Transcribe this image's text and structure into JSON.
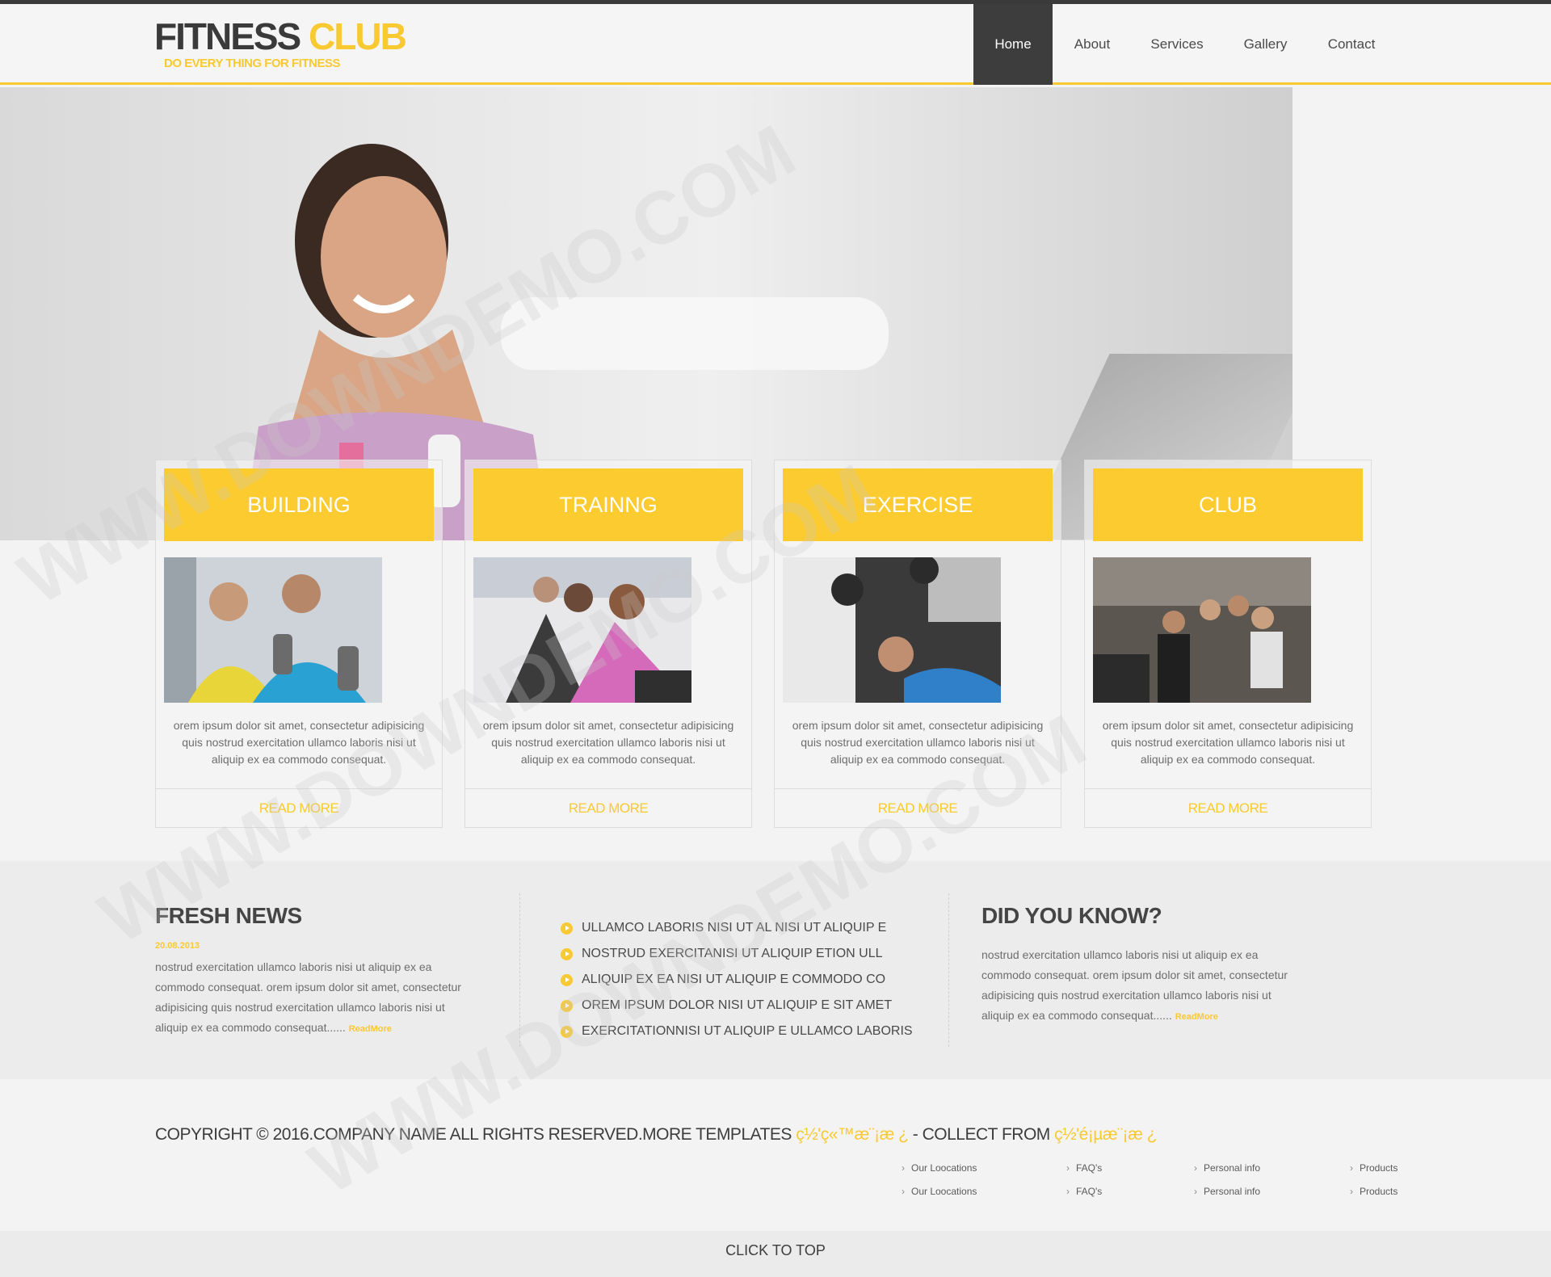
{
  "header": {
    "logo_word1": "FITNESS",
    "logo_word2": "CLUB",
    "tagline": "DO EVERY THING FOR FITNESS",
    "nav": [
      {
        "label": "Home",
        "active": true
      },
      {
        "label": "About"
      },
      {
        "label": "Services"
      },
      {
        "label": "Gallery"
      },
      {
        "label": "Contact"
      }
    ]
  },
  "cards": [
    {
      "title": "BUILDING",
      "text": "orem ipsum dolor sit amet, consectetur adipisicing quis nostrud exercitation ullamco laboris nisi ut aliquip ex ea commodo consequat.",
      "link": "READ MORE"
    },
    {
      "title": "TRAINNG",
      "text": "orem ipsum dolor sit amet, consectetur adipisicing quis nostrud exercitation ullamco laboris nisi ut aliquip ex ea commodo consequat.",
      "link": "READ MORE"
    },
    {
      "title": "EXERCISE",
      "text": "orem ipsum dolor sit amet, consectetur adipisicing quis nostrud exercitation ullamco laboris nisi ut aliquip ex ea commodo consequat.",
      "link": "READ MORE"
    },
    {
      "title": "CLUB",
      "text": "orem ipsum dolor sit amet, consectetur adipisicing quis nostrud exercitation ullamco laboris nisi ut aliquip ex ea commodo consequat.",
      "link": "READ MORE"
    }
  ],
  "news": {
    "title": "FRESH NEWS",
    "date": "20.08.2013",
    "text": "nostrud exercitation ullamco laboris nisi ut aliquip ex ea commodo consequat. orem ipsum dolor sit amet, consectetur adipisicing quis nostrud exercitation ullamco laboris nisi ut aliquip ex ea commodo consequat......",
    "readmore": "ReadMore"
  },
  "list": [
    "ULLAMCO LABORIS NISI UT AL NISI UT ALIQUIP E",
    "NOSTRUD EXERCITANISI UT ALIQUIP ETION ULL",
    "ALIQUIP EX EA NISI UT ALIQUIP E COMMODO CO",
    "OREM IPSUM DOLOR NISI UT ALIQUIP E SIT AMET",
    "EXERCITATIONNISI UT ALIQUIP E ULLAMCO LABORIS"
  ],
  "didyouknow": {
    "title": "DID YOU KNOW?",
    "text": "nostrud exercitation ullamco laboris nisi ut aliquip ex ea commodo consequat. orem ipsum dolor sit amet, consectetur adipisicing quis nostrud exercitation ullamco laboris nisi ut aliquip ex ea commodo consequat......",
    "readmore": "ReadMore"
  },
  "footer": {
    "copyright": "COPYRIGHT © 2016.COMPANY NAME ALL RIGHTS RESERVED.MORE TEMPLATES",
    "templates_link": "ç½'ç«™æ¨¡æ   ¿",
    "collect": " - COLLECT FROM",
    "collect_link": "ç½'é¡µæ¨¡æ   ¿",
    "links_row1": [
      "Our Loocations",
      "FAQ's",
      "Personal info",
      "Products"
    ],
    "links_row2": [
      "Our Loocations",
      "FAQ's",
      "Personal info",
      "Products"
    ],
    "to_top": "CLICK TO TOP"
  },
  "watermark": "WWW.DOWNDEMO.COM",
  "colors": {
    "accent": "#f9c931",
    "dark": "#3d3d3d"
  }
}
